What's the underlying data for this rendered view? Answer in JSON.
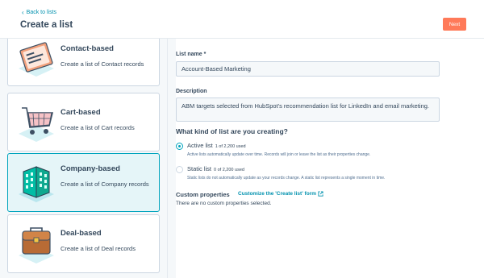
{
  "header": {
    "back_label": "Back to lists",
    "title": "Create a list",
    "next_label": "Next"
  },
  "list_types": [
    {
      "title": "Contact-based",
      "description": "Create a list of Contact records",
      "icon": "contact-card-icon",
      "selected": false
    },
    {
      "title": "Cart-based",
      "description": "Create a list of Cart records",
      "icon": "shopping-cart-icon",
      "selected": false
    },
    {
      "title": "Company-based",
      "description": "Create a list of Company records",
      "icon": "building-icon",
      "selected": true
    },
    {
      "title": "Deal-based",
      "description": "Create a list of Deal records",
      "icon": "briefcase-icon",
      "selected": false
    }
  ],
  "form": {
    "list_name_label": "List name *",
    "list_name_value": "Account-Based Marketing",
    "description_label": "Description",
    "description_value": "ABM targets selected from HubSpot's recommendation list for LinkedIn and email marketing.",
    "question": "What kind of list are you creating?",
    "options": [
      {
        "title": "Active list",
        "count": "1 of 2,200 used",
        "description": "Active lists automatically update over time. Records will join or leave the list as their properties change.",
        "selected": true
      },
      {
        "title": "Static list",
        "count": "0 of 2,200 used",
        "description": "Static lists do not automatically update as your records change. A static list represents a single moment in time.",
        "selected": false
      }
    ],
    "custom_properties_label": "Custom properties",
    "custom_properties_link": "Customize the 'Create list' form",
    "custom_properties_empty": "There are no custom properties selected."
  },
  "colors": {
    "accent": "#00a4bd",
    "link": "#0091ae",
    "primary_button": "#ff7a59",
    "text": "#33475b"
  }
}
